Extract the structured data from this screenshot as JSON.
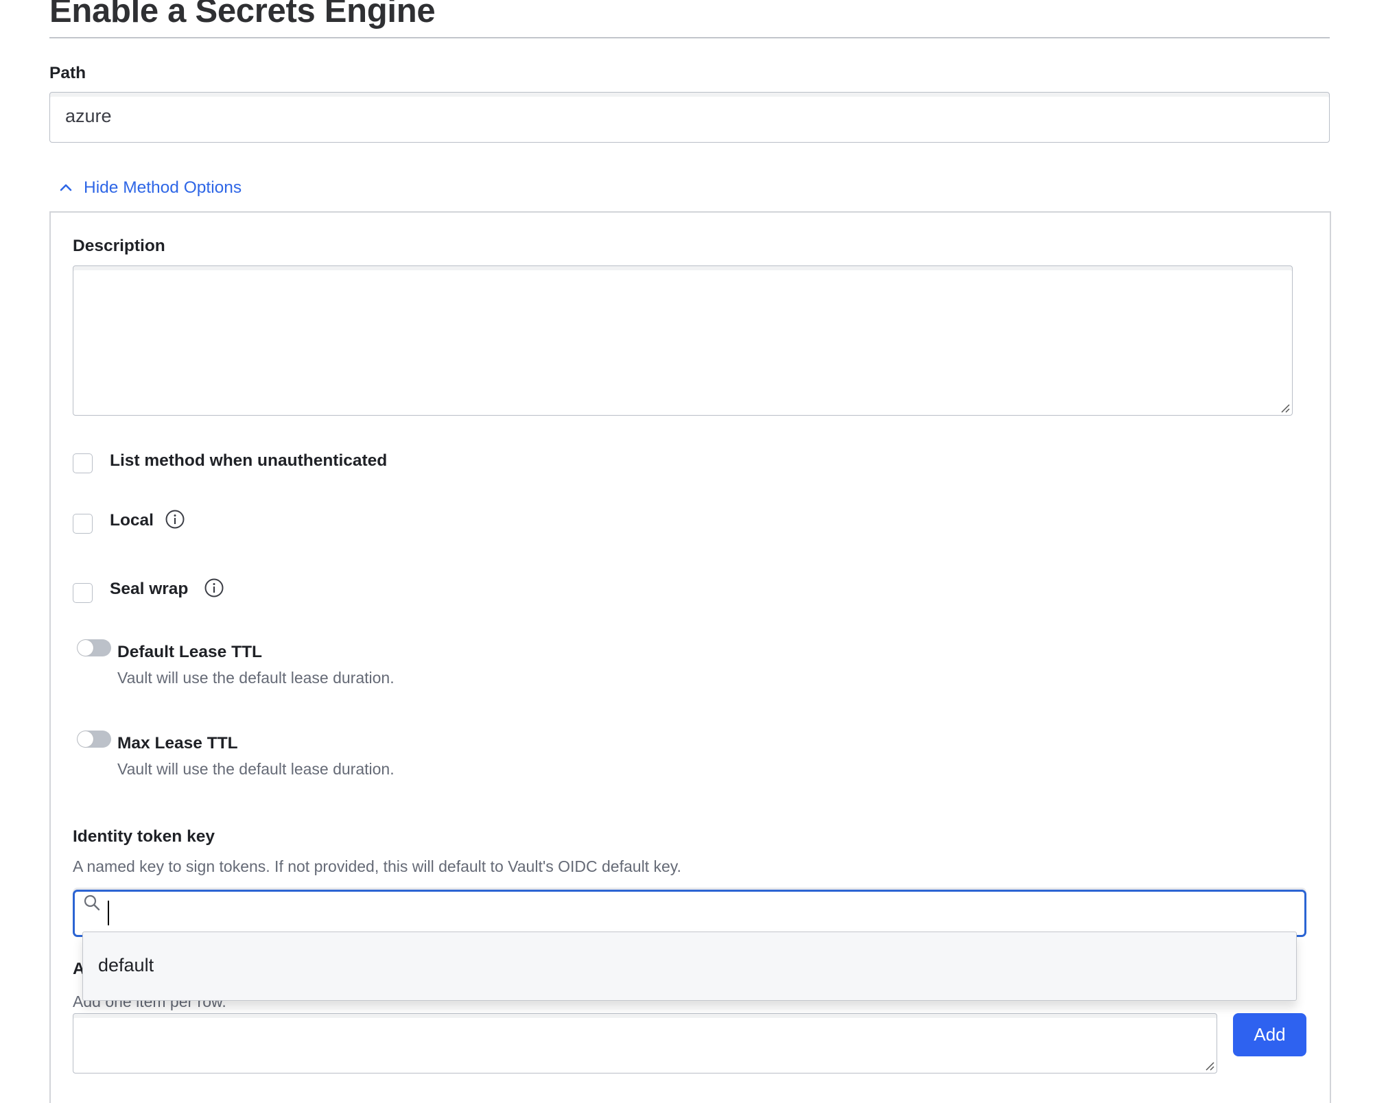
{
  "page": {
    "title": "Enable a Secrets Engine"
  },
  "path": {
    "label": "Path",
    "value": "azure"
  },
  "method_options_toggle": {
    "label": "Hide Method Options",
    "icon": "chevron-up-icon"
  },
  "description": {
    "label": "Description",
    "value": ""
  },
  "checkboxes": [
    {
      "label": "List method when unauthenticated",
      "checked": false,
      "has_info": false
    },
    {
      "label": "Local",
      "checked": false,
      "has_info": true
    },
    {
      "label": "Seal wrap",
      "checked": false,
      "has_info": true
    }
  ],
  "ttl_toggles": [
    {
      "label": "Default Lease TTL",
      "help": "Vault will use the default lease duration.",
      "enabled": false
    },
    {
      "label": "Max Lease TTL",
      "help": "Vault will use the default lease duration.",
      "enabled": false
    }
  ],
  "identity_token_key": {
    "label": "Identity token key",
    "help": "A named key to sign tokens. If not provided, this will default to Vault's OIDC default key.",
    "search_value": "",
    "options": [
      "default"
    ]
  },
  "list_field": {
    "label_partial": "A",
    "help": "Add one item per row.",
    "value": "",
    "add_label": "Add"
  },
  "colors": {
    "accent": "#2e62f0",
    "link": "#2e66e6",
    "focus_border": "#2b64d3"
  }
}
